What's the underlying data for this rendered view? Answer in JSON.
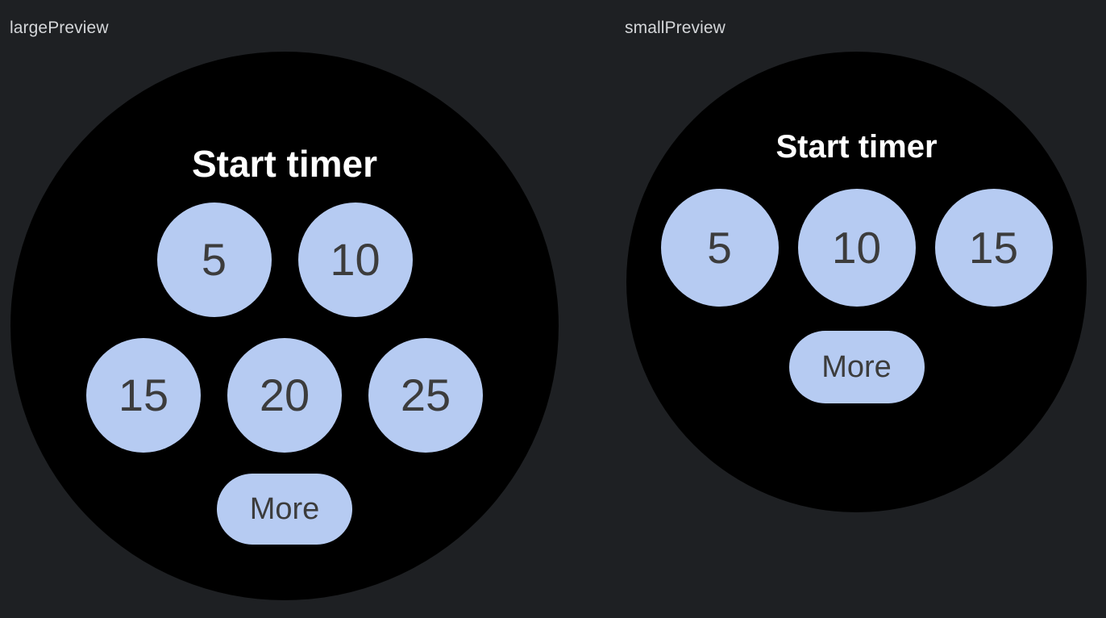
{
  "background_color": "#1e2023",
  "chip_color": "#b6cbf2",
  "chip_text_color": "#3c3c3c",
  "title_color": "#ffffff",
  "label_color": "#d4d6d9",
  "previews": {
    "large": {
      "label": "largePreview",
      "title": "Start timer",
      "rows": [
        {
          "buttons": [
            {
              "label": "5"
            },
            {
              "label": "10"
            }
          ]
        },
        {
          "buttons": [
            {
              "label": "15"
            },
            {
              "label": "20"
            },
            {
              "label": "25"
            }
          ]
        }
      ],
      "more_label": "More"
    },
    "small": {
      "label": "smallPreview",
      "title": "Start timer",
      "rows": [
        {
          "buttons": [
            {
              "label": "5"
            },
            {
              "label": "10"
            },
            {
              "label": "15"
            }
          ]
        }
      ],
      "more_label": "More"
    }
  }
}
